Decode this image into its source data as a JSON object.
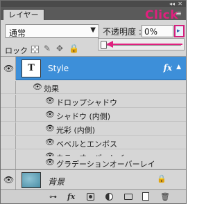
{
  "panel": {
    "tab_label": "レイヤー",
    "collapse_glyph": "◂◂",
    "close_glyph": "✕",
    "menu_glyph": "≡"
  },
  "blend": {
    "value": "通常",
    "arrow_glyph": "▼"
  },
  "opacity": {
    "label": "不透明度 :",
    "value": "0%",
    "arrow_glyph": "▸"
  },
  "annotation": {
    "text": "Click",
    "color": "#e0207e"
  },
  "lock": {
    "label": "ロック :",
    "image_glyph": "✎",
    "position_glyph": "✥",
    "all_glyph": "🔒"
  },
  "layers": {
    "style_layer": {
      "name": "Style",
      "thumbnail_glyph": "T",
      "fx_glyph": "fx",
      "collapse_glyph": "▲"
    },
    "effects_header": "効果",
    "effects": [
      "ドロップシャドウ",
      "シャドウ (内側)",
      "光彩 (内側)",
      "ベベルとエンボス",
      "カラーオーバーレイ",
      "グラデーションオーバーレイ"
    ],
    "background_layer": {
      "name": "背景",
      "lock_glyph": "🔒"
    }
  },
  "icons": {
    "eye_glyph": "👁",
    "link_glyph": "⊶",
    "fx_glyph": "fx",
    "trash_glyph": "🗑"
  },
  "colors": {
    "selection": "#3d8fd9",
    "annotation": "#e0207e",
    "panel_bg": "#d6d6d6"
  }
}
